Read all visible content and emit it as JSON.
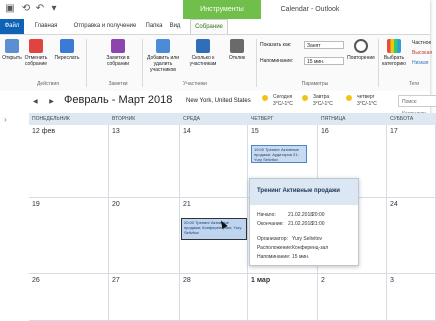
{
  "window": {
    "title": "Calendar - Outlook",
    "context_tab": "Инструменты календаря"
  },
  "tabs": [
    {
      "label": "Файл"
    },
    {
      "label": "Главная"
    },
    {
      "label": "Отправка и получение"
    },
    {
      "label": "Папка"
    },
    {
      "label": "Вид"
    },
    {
      "label": "Собрание"
    }
  ],
  "ribbon": {
    "buttons": [
      {
        "label": "Открыть"
      },
      {
        "label": "Отменить собрание"
      },
      {
        "label": "Переслать"
      },
      {
        "label": "Заметки в собрании"
      },
      {
        "label": "Добавить или удалить участников"
      },
      {
        "label": "Сколько к участникам"
      },
      {
        "label": "Отклик"
      },
      {
        "label": "Выбрать категорию"
      }
    ],
    "groups": [
      "Действия",
      "Заметки",
      "Участники",
      "Параметры",
      "Теги"
    ],
    "show_as": {
      "label": "Показать как:",
      "value": "Занят"
    },
    "reminder": {
      "label": "Напоминание:",
      "value": "15 мин."
    },
    "recurrence": "Повторение",
    "right_tags": [
      "Частное",
      "Высокая",
      "Низкая"
    ]
  },
  "nav": {
    "month_title": "Февраль - Март 2018",
    "location": "New York, United States",
    "weather": [
      {
        "day": "Сегодня",
        "temp": "3°C/-1°C"
      },
      {
        "day": "Завтра",
        "temp": "3°C/-1°C"
      },
      {
        "day": "четверг",
        "temp": "3°C/-1°C"
      }
    ],
    "search_placeholder": "Поиск: Календарь"
  },
  "calendar": {
    "weekdays": [
      "ПОНЕДЕЛЬНИК",
      "ВТОРНИК",
      "СРЕДА",
      "ЧЕТВЕРГ",
      "ПЯТНИЦА",
      "СУББОТА"
    ],
    "weeks": [
      [
        "12 фев",
        "13",
        "14",
        "15",
        "16",
        "17"
      ],
      [
        "19",
        "20",
        "21",
        "22",
        "23",
        "24"
      ],
      [
        "26",
        "27",
        "28",
        "1 мар",
        "2",
        "3"
      ]
    ],
    "events": [
      {
        "text": "19:00 Тренинг Активные продажи; Аудитория 21; Yury Selivitov"
      },
      {
        "text": "20:00 Тренинг Активные продажи; Конференц-зал; Yury Selivitov"
      }
    ]
  },
  "peek": {
    "title": "Тренинг Активные продажи",
    "start_label": "Начало:",
    "start_date": "21.02.2018",
    "start_time": "20:00",
    "end_label": "Окончание:",
    "end_date": "21.02.2018",
    "end_time": "21:00",
    "organizer_label": "Организатор:",
    "organizer": "Yury Selivitov",
    "location_label": "Расположение:",
    "location": "Конференц-зал",
    "reminder_label": "Напоминание:",
    "reminder": "15 мин."
  }
}
